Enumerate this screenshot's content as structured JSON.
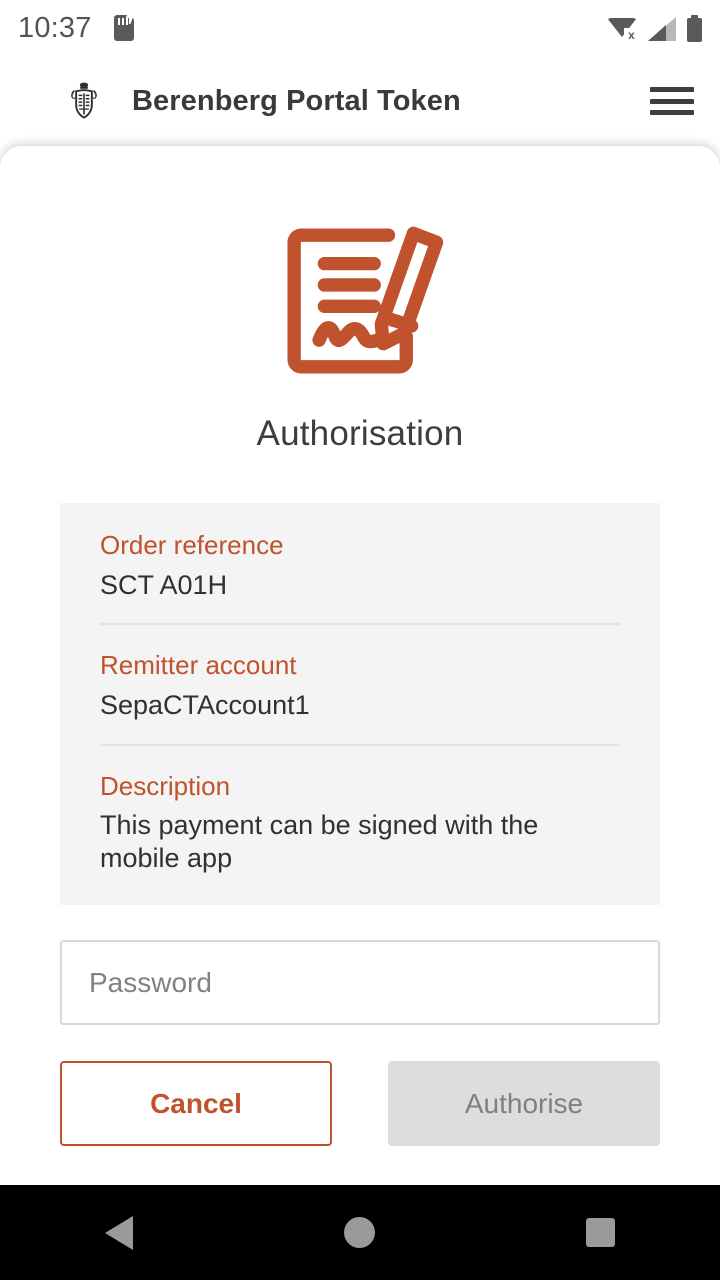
{
  "status_bar": {
    "time": "10:37",
    "sd_card_icon": "sd-card-icon",
    "wifi_icon": "wifi-off-icon",
    "signal_icon": "cellular-signal-icon",
    "battery_icon": "battery-full-icon"
  },
  "app_bar": {
    "logo_icon": "berenberg-crest-icon",
    "title": "Berenberg Portal Token",
    "menu_icon": "hamburger-menu-icon"
  },
  "main": {
    "hero_icon": "document-signature-icon",
    "page_title": "Authorisation",
    "details": [
      {
        "label": "Order reference",
        "value": "SCT A01H"
      },
      {
        "label": "Remitter account",
        "value": "SepaCTAccount1"
      },
      {
        "label": "Description",
        "value": "This payment can be signed with the mobile app"
      }
    ],
    "password": {
      "placeholder": "Password",
      "value": ""
    },
    "buttons": {
      "cancel": "Cancel",
      "authorise": "Authorise"
    }
  },
  "nav_bar": {
    "back_icon": "back-triangle-icon",
    "home_icon": "home-circle-icon",
    "recents_icon": "recents-square-icon"
  },
  "colors": {
    "accent": "#c0522d",
    "panel_bg": "#f4f4f4",
    "disabled_bg": "#dddddd",
    "disabled_text": "#808080",
    "text_primary": "#313131"
  }
}
